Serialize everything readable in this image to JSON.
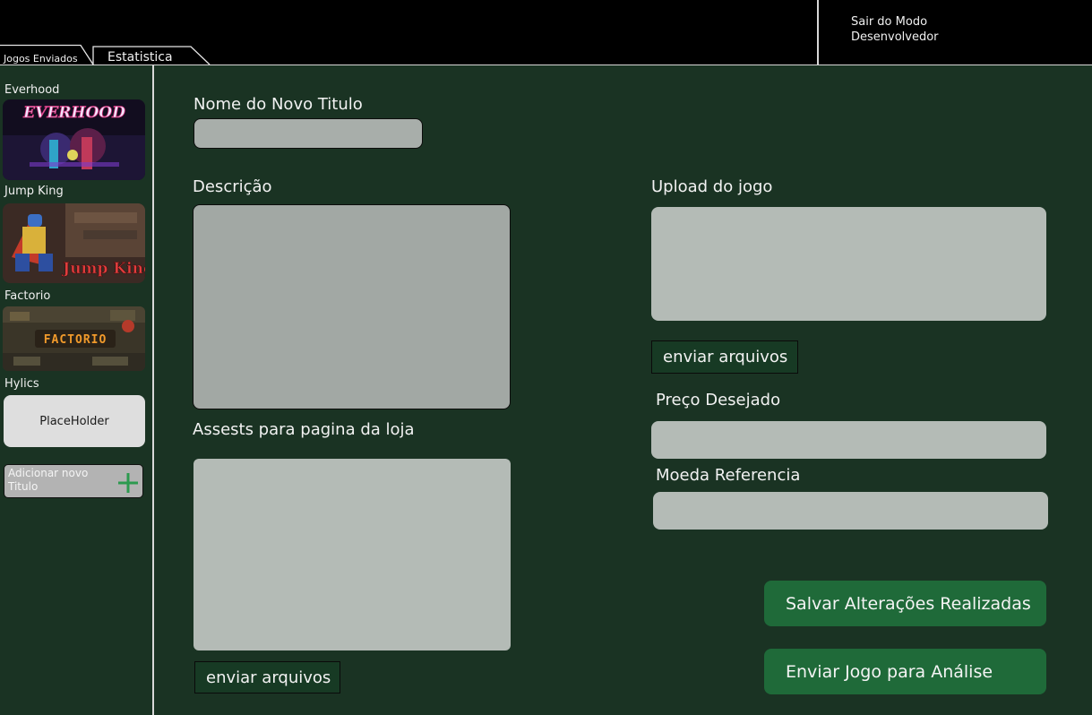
{
  "header": {
    "exit_developer_mode": "Sair do Modo Desenvolvedor"
  },
  "tabs": [
    {
      "label": "Jogos Enviados",
      "active": true
    },
    {
      "label": "Estatistica",
      "active": false
    }
  ],
  "sidebar": {
    "games": [
      {
        "title": "Everhood",
        "thumbnail_text": "EVERHOOD"
      },
      {
        "title": "Jump King",
        "thumbnail_text": "Jump King"
      },
      {
        "title": "Factorio",
        "thumbnail_text": "FACTORIO"
      },
      {
        "title": "Hylics",
        "thumbnail_text": "PlaceHolder"
      }
    ],
    "add_title_label": "Adicionar novo Titulo"
  },
  "form": {
    "name_label": "Nome do Novo Titulo",
    "name_value": "",
    "description_label": "Descrição",
    "description_value": "",
    "store_assets_label": "Assests para pagina da loja",
    "send_files_label": "enviar arquivos",
    "upload_label": "Upload do jogo",
    "price_label": "Preço Desejado",
    "price_value": "",
    "currency_label": "Moeda Referencia",
    "currency_value": "",
    "save_button": "Salvar Alterações Realizadas",
    "submit_button": "Enviar Jogo para Análise"
  },
  "colors": {
    "background": "#1a3323",
    "topbar": "#000000",
    "input": "#b4bbb6",
    "primary_button": "#1f6a39"
  }
}
